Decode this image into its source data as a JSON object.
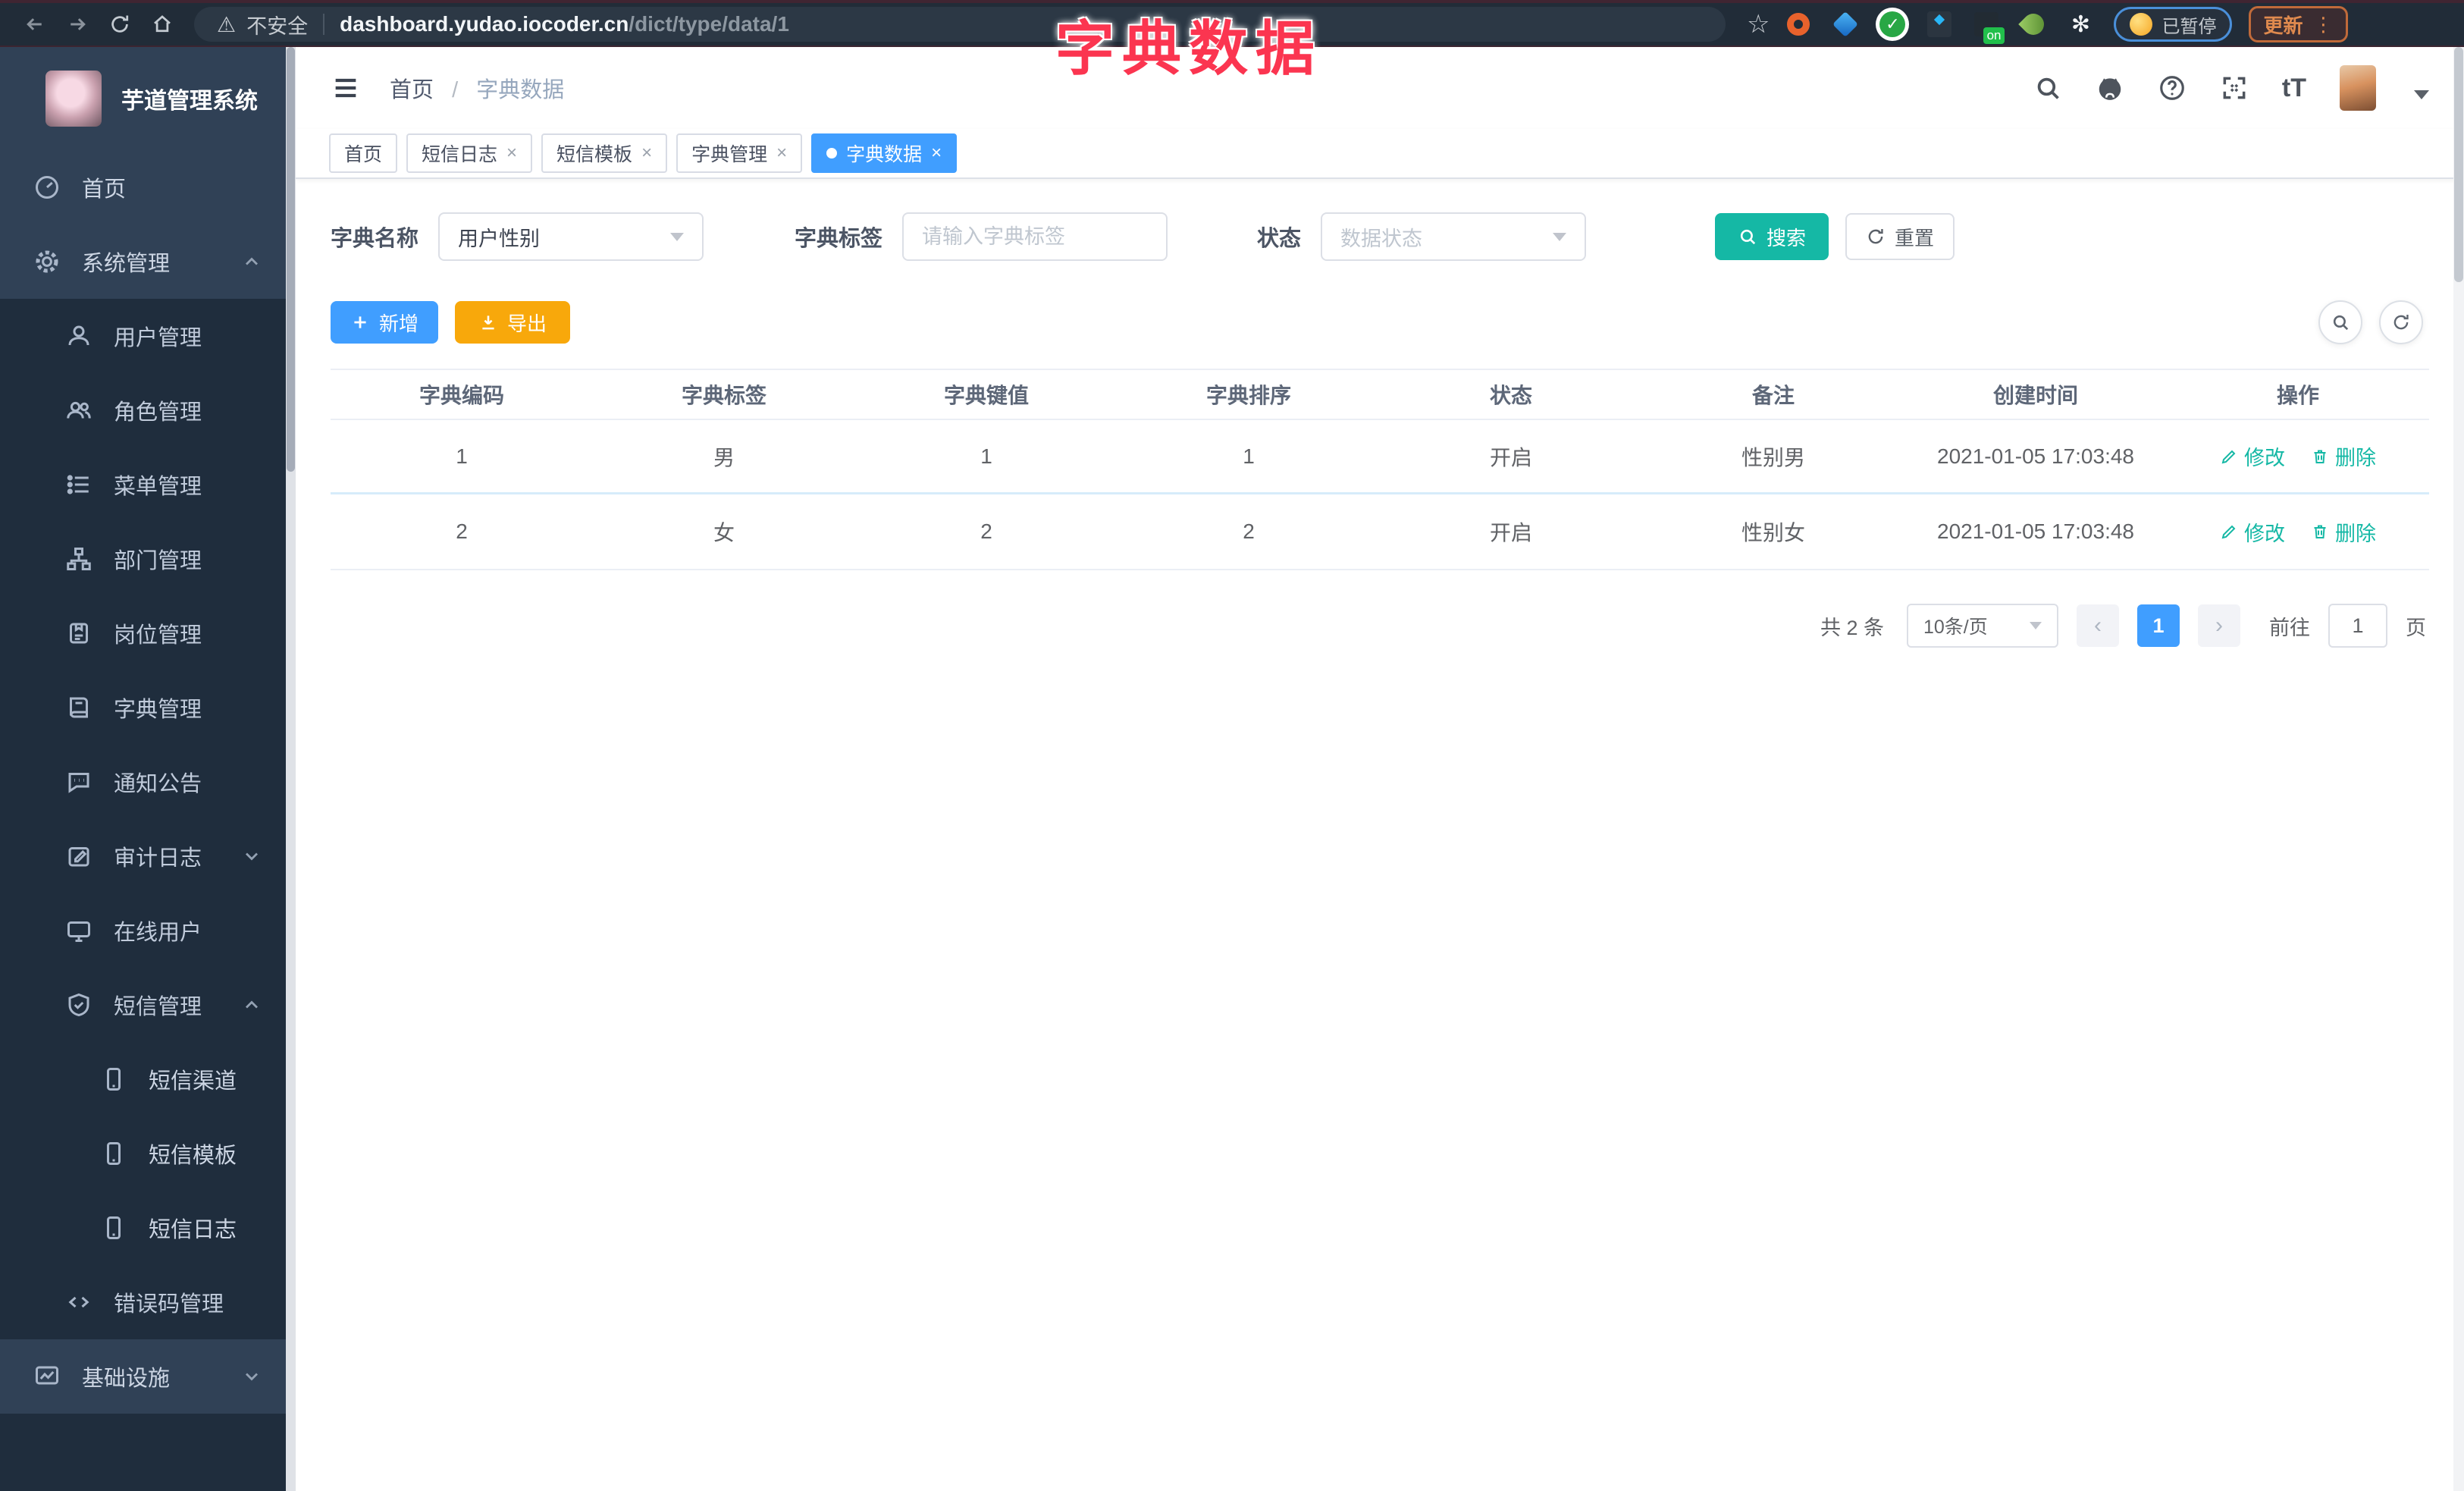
{
  "browser": {
    "security_label": "不安全",
    "url_domain": "dashboard.yudao.iocoder.cn",
    "url_path": "/dict/type/data/1",
    "paused_label": "已暂停",
    "update_label": "更新",
    "nav_icons": [
      "back-arrow",
      "forward-arrow",
      "refresh",
      "home",
      "warning-triangle",
      "bookmark-star",
      "extension-orange-ring",
      "extension-blue-kite",
      "extension-green-check",
      "extension-slider",
      "extension-on-badge",
      "extension-leaf",
      "extension-puzzle",
      "profile-emoji",
      "kebab-menu"
    ]
  },
  "overlay": {
    "title": "字典数据",
    "color": "#fb3550"
  },
  "sidebar": {
    "title": "芋道管理系统",
    "items": [
      {
        "label": "首页",
        "icon": "gauge-icon",
        "level": 0,
        "expanded": null
      },
      {
        "label": "系统管理",
        "icon": "gear-icon",
        "level": 0,
        "expanded": true
      },
      {
        "label": "用户管理",
        "icon": "user-icon",
        "level": 1,
        "expanded": null
      },
      {
        "label": "角色管理",
        "icon": "users-icon",
        "level": 1,
        "expanded": null
      },
      {
        "label": "菜单管理",
        "icon": "list-icon",
        "level": 1,
        "expanded": null
      },
      {
        "label": "部门管理",
        "icon": "tree-icon",
        "level": 1,
        "expanded": null
      },
      {
        "label": "岗位管理",
        "icon": "badge-icon",
        "level": 1,
        "expanded": null
      },
      {
        "label": "字典管理",
        "icon": "book-icon",
        "level": 1,
        "expanded": null
      },
      {
        "label": "通知公告",
        "icon": "chat-icon",
        "level": 1,
        "expanded": null
      },
      {
        "label": "审计日志",
        "icon": "edit-icon",
        "level": 1,
        "expanded": false
      },
      {
        "label": "在线用户",
        "icon": "online-icon",
        "level": 1,
        "expanded": null
      },
      {
        "label": "短信管理",
        "icon": "shield-icon",
        "level": 1,
        "expanded": true
      },
      {
        "label": "短信渠道",
        "icon": "phone-icon",
        "level": 2,
        "expanded": null
      },
      {
        "label": "短信模板",
        "icon": "phone-icon",
        "level": 2,
        "expanded": null
      },
      {
        "label": "短信日志",
        "icon": "phone-icon",
        "level": 2,
        "expanded": null
      },
      {
        "label": "错误码管理",
        "icon": "code-icon",
        "level": 1,
        "expanded": null
      },
      {
        "label": "基础设施",
        "icon": "chart-icon",
        "level": 0,
        "expanded": false
      }
    ]
  },
  "header": {
    "breadcrumb_home": "首页",
    "breadcrumb_separator": "/",
    "breadcrumb_current": "字典数据",
    "right_icons": [
      "search-icon",
      "github-icon",
      "question-icon",
      "fullscreen-icon",
      "font-size-icon",
      "avatar",
      "caret-down-icon"
    ],
    "font_size_glyph": "tT"
  },
  "tabs": {
    "items": [
      {
        "label": "首页",
        "closable": false,
        "active": false
      },
      {
        "label": "短信日志",
        "closable": true,
        "active": false
      },
      {
        "label": "短信模板",
        "closable": true,
        "active": false
      },
      {
        "label": "字典管理",
        "closable": true,
        "active": false
      },
      {
        "label": "字典数据",
        "closable": true,
        "active": true
      }
    ],
    "close_glyph": "×"
  },
  "filters": {
    "name_label": "字典名称",
    "name_value": "用户性别",
    "label_label": "字典标签",
    "label_placeholder": "请输入字典标签",
    "status_label": "状态",
    "status_placeholder": "数据状态",
    "search_label": "搜索",
    "reset_label": "重置"
  },
  "toolbar": {
    "add_label": "新增",
    "export_label": "导出",
    "round_buttons": [
      "show-search-icon",
      "refresh-icon"
    ]
  },
  "table": {
    "columns": [
      "字典编码",
      "字典标签",
      "字典键值",
      "字典排序",
      "状态",
      "备注",
      "创建时间",
      "操作"
    ],
    "rows": [
      {
        "code": "1",
        "label": "男",
        "value": "1",
        "sort": "1",
        "status": "开启",
        "remark": "性别男",
        "time": "2021-01-05 17:03:48"
      },
      {
        "code": "2",
        "label": "女",
        "value": "2",
        "sort": "2",
        "status": "开启",
        "remark": "性别女",
        "time": "2021-01-05 17:03:48"
      }
    ],
    "edit_label": "修改",
    "delete_label": "删除"
  },
  "pagination": {
    "total": "共 2 条",
    "page_size": "10条/页",
    "current_page": "1",
    "goto_label": "前往",
    "goto_value": "1",
    "page_suffix": "页"
  },
  "colors": {
    "primary": "#409eff",
    "teal": "#15b8a5",
    "warning": "#f8a80b",
    "sidebar_light": "#304156",
    "sidebar_dark": "#1f2d3d",
    "overlay_pink": "#fb3550"
  }
}
